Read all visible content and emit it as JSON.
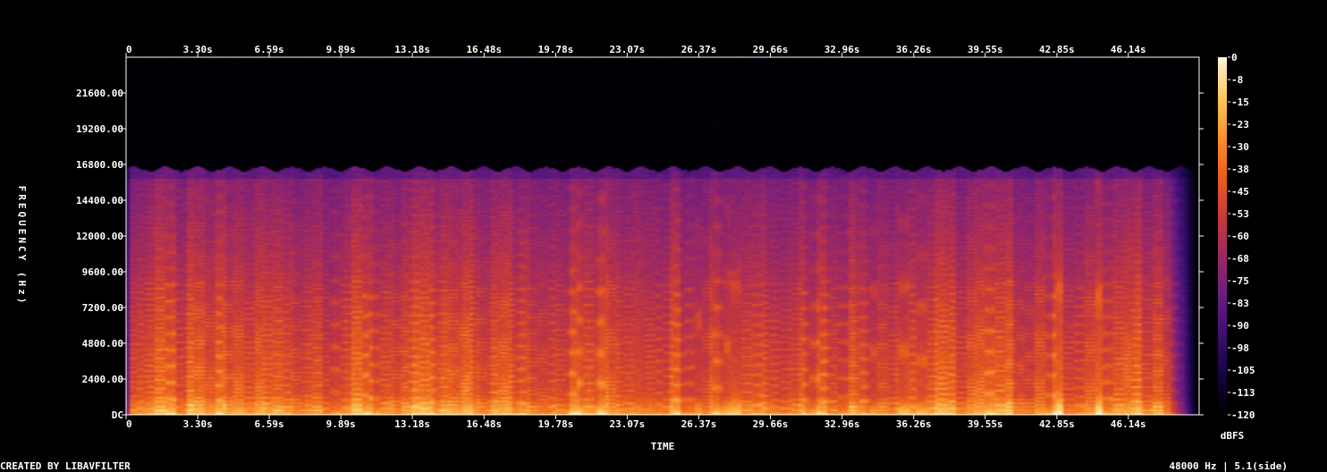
{
  "chart_data": {
    "type": "heatmap",
    "title": "",
    "xlabel": "TIME",
    "ylabel": "FREQUENCY (Hz)",
    "time_ticks": [
      "0",
      "3.30s",
      "6.59s",
      "9.89s",
      "13.18s",
      "16.48s",
      "19.78s",
      "23.07s",
      "26.37s",
      "29.66s",
      "32.96s",
      "36.26s",
      "39.55s",
      "42.85s",
      "46.14s"
    ],
    "time_tick_values": [
      0,
      3.3,
      6.59,
      9.89,
      13.18,
      16.48,
      19.78,
      23.07,
      26.37,
      29.66,
      32.96,
      36.26,
      39.55,
      42.85,
      46.14
    ],
    "xlim": [
      0,
      49.4
    ],
    "freq_ticks": [
      "DC",
      "2400.00",
      "4800.00",
      "7200.00",
      "9600.00",
      "12000.00",
      "14400.00",
      "16800.00",
      "19200.00",
      "21600.00"
    ],
    "freq_tick_values": [
      0,
      2400,
      4800,
      7200,
      9600,
      12000,
      14400,
      16800,
      19200,
      21600
    ],
    "ylim": [
      0,
      24000
    ],
    "colorbar": {
      "label": "dBFS",
      "ticks": [
        "0",
        "-8",
        "-15",
        "-23",
        "-30",
        "-38",
        "-45",
        "-53",
        "-60",
        "-68",
        "-75",
        "-83",
        "-90",
        "-98",
        "-105",
        "-113",
        "-120"
      ],
      "range": [
        -120,
        0
      ],
      "colors": [
        "#000000",
        "#14043c",
        "#3b0f70",
        "#6a1c81",
        "#9a2865",
        "#c83a3a",
        "#ea5e1c",
        "#f9932f",
        "#fdc95e",
        "#fff6d6"
      ]
    },
    "spectrum": {
      "cutoff_hz": 16500,
      "signal_end_s": 48.0
    }
  },
  "footer": {
    "credit": "CREATED BY LIBAVFILTER",
    "info": "48000 Hz | 5.1(side)"
  }
}
